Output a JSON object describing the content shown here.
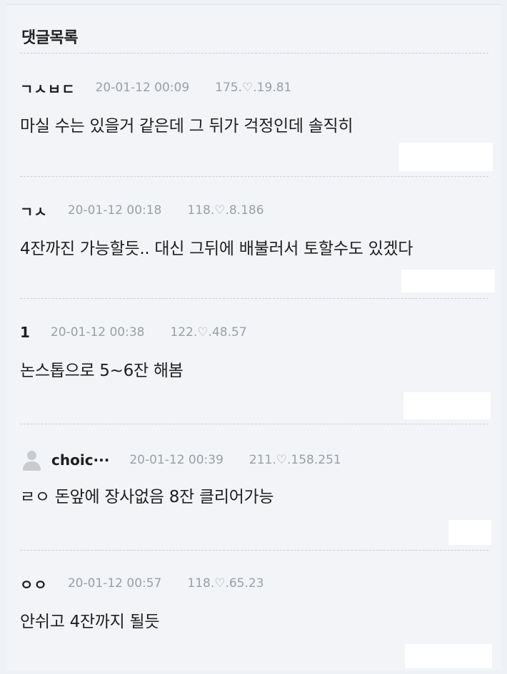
{
  "section_title": "댓글목록",
  "icons": {
    "avatar": "default-user-avatar-icon"
  },
  "comments": [
    {
      "nick": "ㄱㅅㅂㄷ",
      "date": "20-01-12 00:09",
      "ip": "175.♡.19.81",
      "text": "마실 수는 있을거 같은데 그 뒤가 걱정인데 솔직히"
    },
    {
      "nick": "ㄱㅅ",
      "date": "20-01-12 00:18",
      "ip": "118.♡.8.186",
      "text": "4잔까진 가능할듯.. 대신 그뒤에 배불러서 토할수도 있겠다"
    },
    {
      "nick": "1",
      "date": "20-01-12 00:38",
      "ip": "122.♡.48.57",
      "text": "논스톱으로 5~6잔 해봄"
    },
    {
      "nick": "choic···",
      "date": "20-01-12 00:39",
      "ip": "211.♡.158.251",
      "text": "ㄹㅇ 돈앞에 장사없음 8잔 클리어가능"
    },
    {
      "nick": "ㅇㅇ",
      "date": "20-01-12 00:57",
      "ip": "118.♡.65.23",
      "text": "안쉬고 4잔까지 될듯"
    }
  ]
}
